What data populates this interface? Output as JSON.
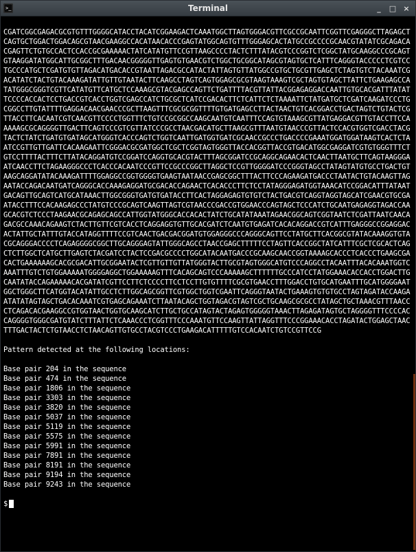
{
  "window": {
    "title": "Terminal",
    "min_label": "_",
    "max_label": "□",
    "close_label": "×"
  },
  "sequence_text": "CGATCGGCGAGACGCGTGTTTGGGGCATACCTACATCGGAAGACTCAAATGGCTTAGTGGGACGTTCGCCGCAATTCGGTTCGAGGGCTTAGAGCTCAGTGCTGGACTGGACAGCGTAACGAAGGCCACATAACACCCGAGTATGGCAGTGTTTGGGAGCACTATGCCGCCCCGCAACGTATATCGCAGACACGAGTTCTGTGCCACTCCACCGCGAAAAACTATCATATGTTCCGTTAAGCCCCTACTCTTTATACGTCCCGGTCTCGGCTATGCAAGGCCCGCAGTGTAAGGATATGGCATTGCGGCTTTGACAACGGGGGTTGAGTGTGAACGTCTGGCTGCGGCATAGCGTAGTGCTCATTTCAGGGTACCCCCTCGTCCTGCCCATGCTCGATGTGTTAGACATGACACCGTAATTAGACGCCATACTATTAGTGTTATGGCCGTGCTGCGTTGAGCTCTAGTGTCTACAAATCGACATATCTACTGTACAAAGATATTGTTGTAATACTTCAAGCCTAGTCAGTGGAGCGCGTAAGTAAAGTCGCTAGTGTAGCTTATTCTGAAGAGCCATATGGGCGGGTCGTTCATATGTTCATGCTCCAAAGCGTACGAGCCAGTTCTGATTTTACGTTATTACGGAGAGGACCAATTGTGCACGATTTATATTCCCCACCACTCCTGACCGTCACCTGGTCGAGCCATCTGCGCTCATCCGACACTTCTCATTCTCTAAAATTCTATGATGCTCGATCAAGATCCCTGCGGCCTTGTATTTTGAGGACAACGAACCCGCTTAAGTTTCGCGCGGTTTTGTGATGAGCCTTACTAACTGTCACGGACCTGACTAGTCTGTACTCGTTACCTTCACAATCGTCAACGTTCCCCTGGTTTCTGTCCGCGGCCAAGCAATGTCAATTTCCAGTGTAAAGCGTTATGAGGACGTTGTACCTTCCAAAAAGCGCAGGGGTTGACTTCAGTCCCGTCGTTATCCCGCCTAACGACATGCTTAAGCGTTTAATGTAACCCGTTACTCCACGTGGTCGACCTACGTACTCTATCTGATGTGATAGCATGGGTCACCCAGTCTGGTCAATTGATGGTGATCGCAACCGCCCTGACCCCGAAATGGATGGATAAGTCACTCTAATCCGTTGTTGATTCACAAGAATTCGGGACGCGATGGCTCGCTCGGTAGTGGGTTACCACGGTTACCGTGACATGGCGAGGATCGTGTGGGTTTCTGTCCTTTTACTTTCTTATACAGGATGTCCGGATCCAGGTGCACGTACTTTAGCGGATCCGCAGGCAGAACACTCAACTTAATGCTTCAGTAAGGGAATCAACCTTCTAGAAGGGCCCTCACCCACAATCCCGTTCCGCCCGGCTTAGGCTCCGTTGGGGATCCCGGGTAGCCTATAGTATGTGCCTGACTGTAAGCAGGATATACAAAGATTTTGGAGGCCGGTGGGGTGAAGTAATAACCGAGCGGCTTTACTTCCCAGAAGATGACCCTAATACTGTACAAGTTAGAATACCAGACAATGATCAGGGCACCAAAGAGGATGCGACACCAGAACTCACACCCTTCTCCTATAGGGAGATGGTAAACATCCGGACATTTATAATGACAGTTGCAGTCATGCATAAACTTGGCGGGTGATGTGATACCTTCACTAGGAGAGTGTGTCTACTGACGTCAGGTAGGTAGCATCGAACGTGCGAATACCTTTCCACAAGAGCCCTATGTCCCGCAGTCAAGTTAGTCGTAACCCGACCGTGGAACCCAGTAGCTCCCATCTGCAATGAGAGGTAGACCAAGCACGTCTCCCTAAGAACGCAGAGCAGCCATTGGTATGGGCACCACACTATCTGCATATAAATAGAACGGCAGTCGGTAATCTCGATTAATCAACAGACGCCAAACAGAAGTCTACTTGTTCGTCACCTCAGGAGGTGTTGCACGATCTCAATGTGAGATCACACAGGACCGTCATTTGAGGGCCGGAGGACACTATTGCTATTTGTACCATAGGTTTTCCGTCAACTGACGACGGATGTGGAGGGCCCAGGGCAGTTCCTATGCTTCACGGCGTATACAAAGGTGTACGCAGGGACCCCTCAGAGGGGCGGCTTGCAGGGAGTATTGGGCAGCCTAACCGAGCTTTTTCCTAGTTCACCGGCTATCATTTCGCTCGCACTCAGCTCTTGGCTCATGCTTGAGTCTACGATCCTACTCCGACGCCCCTGGCATACAATGACCCGCAAGCAACCGGTAAAAGCACCCTCACCCTGAAGCGACACTGAAAAAAGCACGCGACATTGCGGAATACTCGTTGTTGTTATGGGTACTTGCGTAGTGGGCATGTCCCAGGCCTACAATTTACACAAATGGTCAAATTTGTCTGTGGAAAAATGGGGAGGCTGGAAAAAGTTTCACAGCAGTCCCAAAAAGCTTTTTTGCCCATCCTATGGAAACACCACCTGGACTTGCAATATACCAGAAAAACACGATATCGTTCCTTCTCCCCTTCCTCCTTGTGTTTTCGCGTGAACCTTTGGACCTGTGCATGAATTTGCATGGGGAATGGCTGGGCTTCATGGTACATATTGCCTCTTGGCAGCGGTTCGTGGCTGGTCGAATTCAGGGTAATACTGAAAGTGTGTGCCTAGTAGATACCAAGAATATATAGTAGCTGACACAAATCGTGAGCAGAAATCTTAATACAGCTGGTAGACGTAGTCGCTGCAAGCGCGCCTATAGCTGCTAAACGTTTAACCCTCAGACACGAAGGCCGTGGTAACTGGTGCAAGCATCTTGCTGCCATAGTACTAGAGTGGGGGTAAACTTAGAGATAGTGCTAGGGGTTTCCCCACCAGGGGTGGGCGATGTATCTTTATTCTCAAACCCTCGGTTTCCCAAATGTTCCAAGTTATTAGGTTTCCCGGAAACACCTAGATACTGGAGCTAACTTTGACTACTCTGTAACCTCTAACAGTTGTGCCTACGTCCCTGAAGACATTTTTGTCCACAATCTGTCCGTTCCG",
  "detected_message": "Pattern detected at the following locations:",
  "results": [
    "Base pair 204 in the sequence",
    "Base pair 474 in the sequence",
    "Base pair 1806 in the sequence",
    "Base pair 3303 in the sequence",
    "Base pair 3820 in the sequence",
    "Base pair 5037 in the sequence",
    "Base pair 5119 in the sequence",
    "Base pair 5575 in the sequence",
    "Base pair 5991 in the sequence",
    "Base pair 7891 in the sequence",
    "Base pair 8191 in the sequence",
    "Base pair 9194 in the sequence",
    "Base pair 9243 in the sequence"
  ],
  "prompt": "$"
}
